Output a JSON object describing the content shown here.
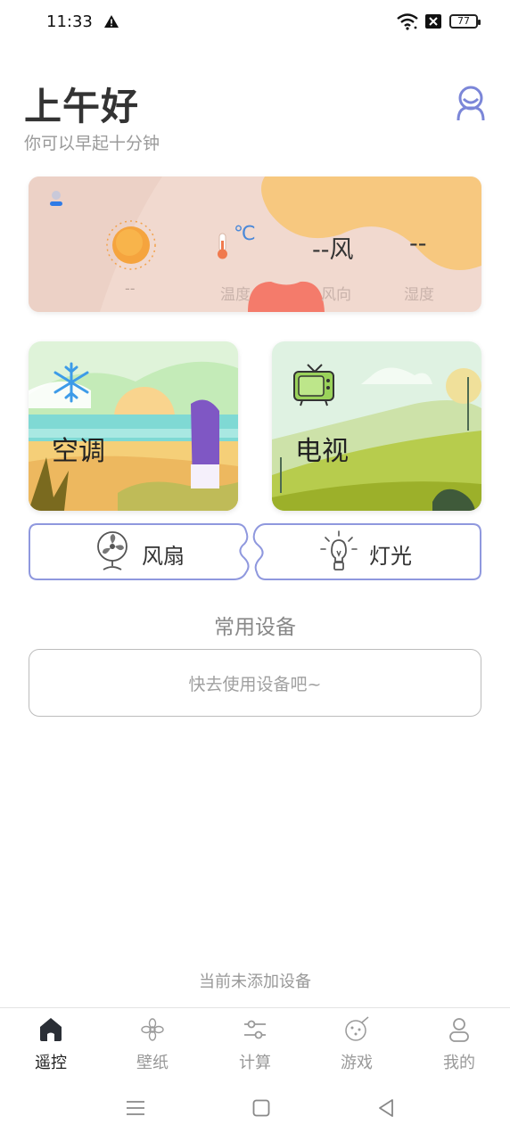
{
  "status_bar": {
    "time": "11:33",
    "battery": "77"
  },
  "header": {
    "greeting": "上午好",
    "subtitle": "你可以早起十分钟"
  },
  "weather": {
    "condition_value": "--",
    "temperature_label": "温度",
    "temperature_unit": "℃",
    "wind_value": "--风",
    "wind_label": "风向",
    "humidity_value": "--",
    "humidity_label": "湿度"
  },
  "devices": {
    "ac_label": "空调",
    "tv_label": "电视",
    "fan_label": "风扇",
    "light_label": "灯光"
  },
  "common": {
    "title": "常用设备",
    "empty_text": "快去使用设备吧~"
  },
  "footer_status": "当前未添加设备",
  "tabbar": {
    "items": [
      {
        "label": "遥控",
        "icon": "home-icon",
        "active": true
      },
      {
        "label": "壁纸",
        "icon": "flower-icon",
        "active": false
      },
      {
        "label": "计算",
        "icon": "sliders-icon",
        "active": false
      },
      {
        "label": "游戏",
        "icon": "gamepad-icon",
        "active": false
      },
      {
        "label": "我的",
        "icon": "user-icon",
        "active": false
      }
    ]
  },
  "colors": {
    "accent": "#7b86d8",
    "active_tab": "#222222",
    "inactive_tab": "#999999"
  }
}
